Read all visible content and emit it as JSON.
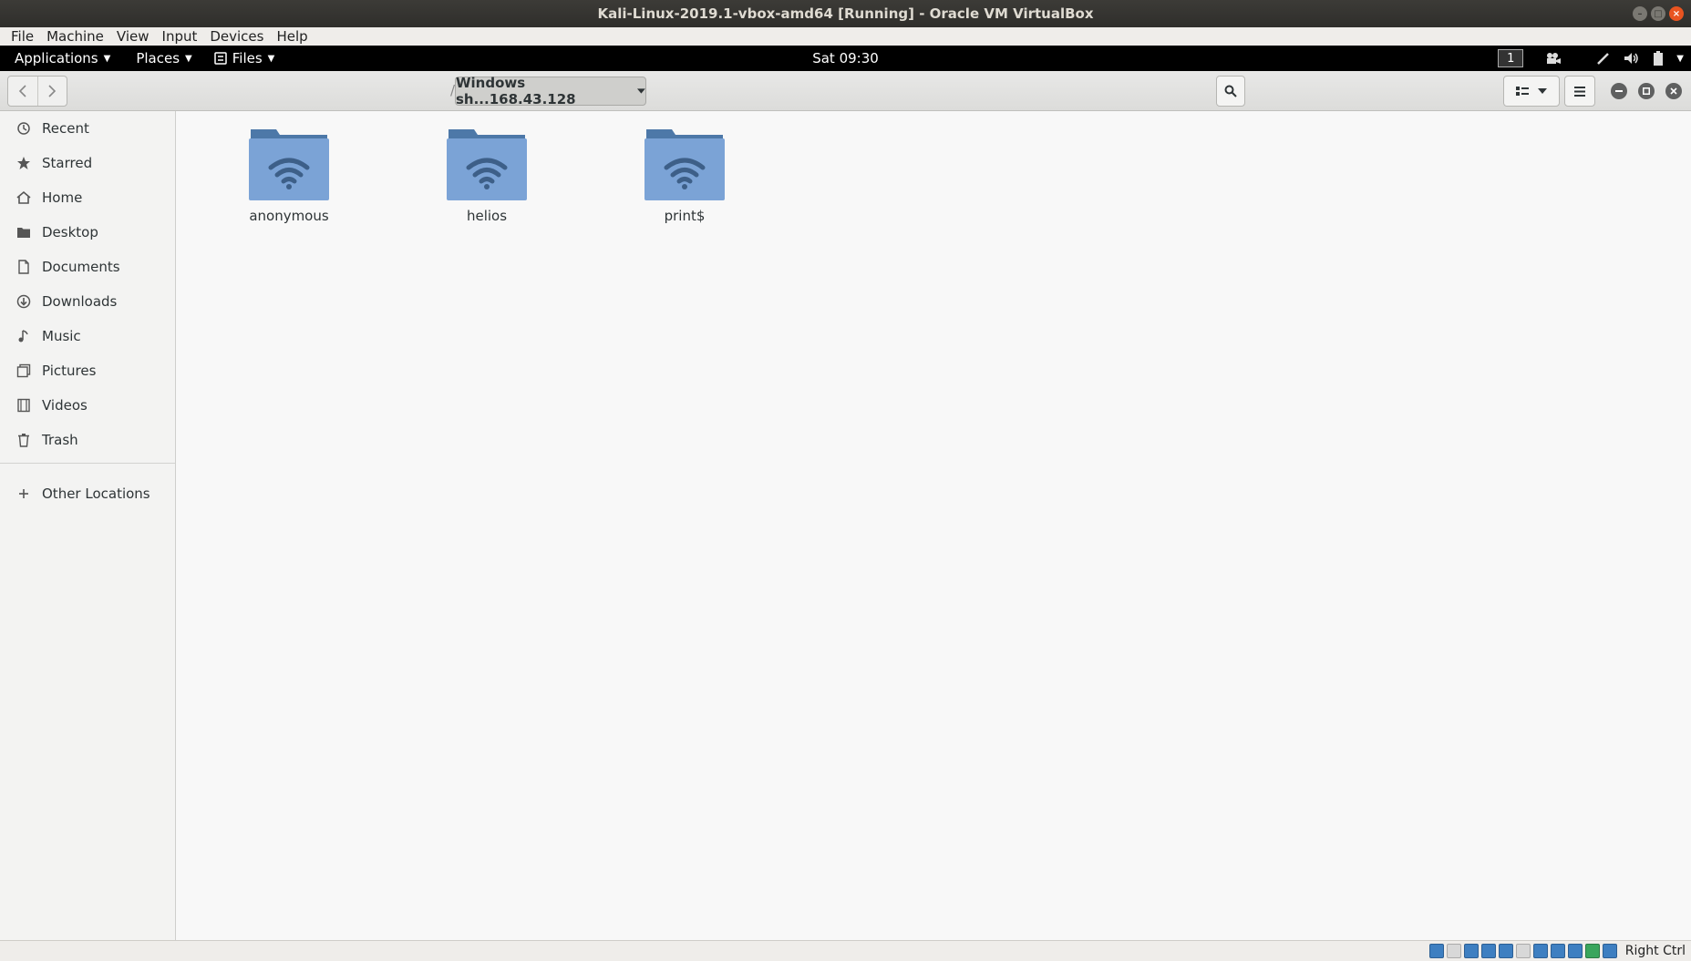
{
  "host_window": {
    "title": "Kali-Linux-2019.1-vbox-amd64 [Running] - Oracle VM VirtualBox"
  },
  "vbox_menu": [
    "File",
    "Machine",
    "View",
    "Input",
    "Devices",
    "Help"
  ],
  "guest_panel": {
    "applications": "Applications",
    "places": "Places",
    "files": "Files",
    "clock": "Sat 09:30",
    "workspace": "1"
  },
  "nautilus": {
    "path_separator": "/",
    "location": "Windows sh...168.43.128",
    "sidebar": [
      {
        "label": "Recent",
        "icon": "recent-icon"
      },
      {
        "label": "Starred",
        "icon": "star-icon"
      },
      {
        "label": "Home",
        "icon": "home-icon"
      },
      {
        "label": "Desktop",
        "icon": "desktop-folder-icon"
      },
      {
        "label": "Documents",
        "icon": "document-icon"
      },
      {
        "label": "Downloads",
        "icon": "download-icon"
      },
      {
        "label": "Music",
        "icon": "music-icon"
      },
      {
        "label": "Pictures",
        "icon": "pictures-icon"
      },
      {
        "label": "Videos",
        "icon": "videos-icon"
      },
      {
        "label": "Trash",
        "icon": "trash-icon"
      },
      {
        "label": "Other Locations",
        "icon": "plus-icon"
      }
    ],
    "shares": [
      {
        "name": "anonymous"
      },
      {
        "name": "helios"
      },
      {
        "name": "print$"
      }
    ]
  },
  "statusbar": {
    "host_key": "Right Ctrl"
  },
  "colors": {
    "folder": "#7ba3d6",
    "folder_tab": "#4d78a8",
    "accent": "#e95420"
  }
}
